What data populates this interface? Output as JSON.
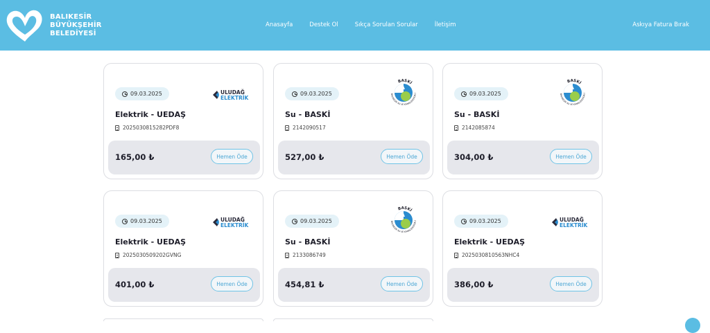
{
  "header": {
    "logo_lines": [
      "BALIKESİR",
      "BÜYÜKŞEHİR",
      "BELEDİYESİ"
    ],
    "nav": [
      "Anasayfa",
      "Destek Ol",
      "Sıkça Sorulan Sorular",
      "İletişim"
    ],
    "askiya": "Askıya Fatura Bırak"
  },
  "colors": {
    "header_bg": "#5bbde3",
    "pay_border": "#6fc3e6",
    "card_bottom": "#e6e7ec"
  },
  "uedas_logo": {
    "top": "ULUDAĞ",
    "bottom": "ELEKTRİK"
  },
  "baski_logo": {
    "arc_top": "BASKİ",
    "arc_bottom": "BALIKESİR SU VE KANALİZASYON İDARESİ"
  },
  "pay_label": "Hemen Öde",
  "cards": [
    {
      "date": "09.03.2025",
      "provider": "Elektrik - UEDAŞ",
      "doc": "2025030815282PDF8",
      "amount": "165,00 ₺",
      "logo": "uedas-logo"
    },
    {
      "date": "09.03.2025",
      "provider": "Su - BASKİ",
      "doc": "2142090517",
      "amount": "527,00 ₺",
      "logo": "baski-logo"
    },
    {
      "date": "09.03.2025",
      "provider": "Su - BASKİ",
      "doc": "2142085874",
      "amount": "304,00 ₺",
      "logo": "baski-logo"
    },
    {
      "date": "09.03.2025",
      "provider": "Elektrik - UEDAŞ",
      "doc": "2025030509202GVNG",
      "amount": "401,00 ₺",
      "logo": "uedas-logo"
    },
    {
      "date": "09.03.2025",
      "provider": "Su - BASKİ",
      "doc": "2133086749",
      "amount": "454,81 ₺",
      "logo": "baski-logo"
    },
    {
      "date": "09.03.2025",
      "provider": "Elektrik - UEDAŞ",
      "doc": "2025030810563NHC4",
      "amount": "386,00 ₺",
      "logo": "uedas-logo"
    }
  ]
}
